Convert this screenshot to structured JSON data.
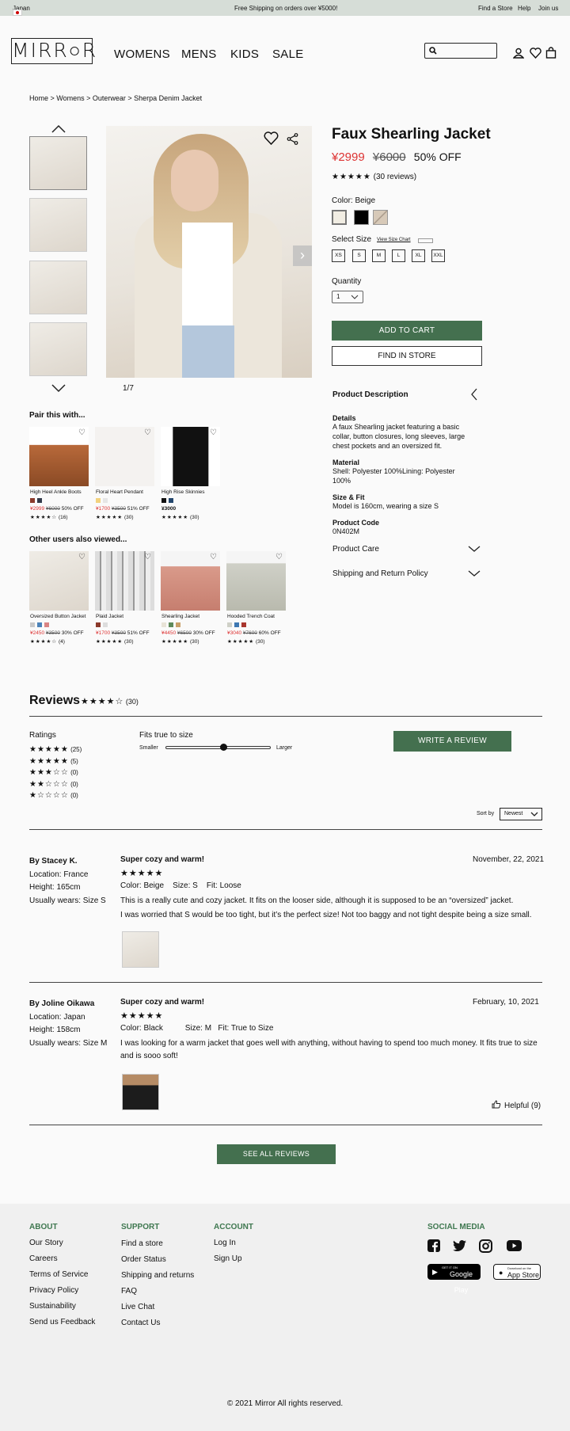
{
  "topbar": {
    "country": "Japan",
    "promo": "Free Shipping on orders over ¥5000!",
    "find_store": "Find a Store",
    "help": "Help",
    "join": "Join us"
  },
  "brand": {
    "logo": "MIRR○R"
  },
  "nav": {
    "womens": "WOMENS",
    "mens": "MENS",
    "kids": "KIDS",
    "sale": "SALE"
  },
  "breadcrumb": "Home > Womens > Outerwear > Sherpa Denim Jacket",
  "gallery": {
    "counter": "1/7"
  },
  "product": {
    "title": "Faux Shearling Jacket",
    "price": "¥2999",
    "old_price": "¥6000",
    "discount": "50% OFF",
    "stars": "★★★★★",
    "reviews": "(30 reviews)",
    "color_label": "Color: Beige",
    "colors": [
      "#f1ede3",
      "#000000",
      "#cbb9a7"
    ],
    "size_label": "Select Size",
    "size_chart": "View Size Chart",
    "sizes": [
      "XS",
      "S",
      "M",
      "L",
      "XL",
      "XXL"
    ],
    "quantity_label": "Quantity",
    "quantity": "1",
    "add_to_cart": "ADD TO CART",
    "find_in_store": "FIND IN STORE",
    "desc_title": "Product Description",
    "details_title": "Details",
    "details": "A faux Shearling jacket featuring a basic collar, button closures, long sleeves, large chest pockets and an oversized fit.",
    "material_title": "Material",
    "material": "Shell: Polyester 100%Lining: Polyester 100%",
    "fit_title": "Size & Fit",
    "fit": "Model is 160cm, wearing a size S",
    "code_title": "Product Code",
    "code": "0N402M",
    "care": "Product Care",
    "shipping": "Shipping and Return Policy"
  },
  "pair": {
    "title": "Pair this with...",
    "items": [
      {
        "name": "High Heel Ankle Boots",
        "price": "¥2999",
        "old": "¥6000",
        "off": "50% OFF",
        "stars": "★★★★☆",
        "count": "(16)",
        "colors": [
          "#8b3b2b",
          "#333a4a"
        ]
      },
      {
        "name": "Floral Heart Pendant",
        "price": "¥1700",
        "old": "¥3500",
        "off": "51% OFF",
        "stars": "★★★★★",
        "count": "(30)",
        "colors": [
          "#f2d27e",
          "#e6e6e6"
        ]
      },
      {
        "name": "High Rise Skinnies",
        "price": "¥3000",
        "old": "",
        "off": "",
        "stars": "★★★★★",
        "count": "(30)",
        "colors": [
          "#111111",
          "#23466c"
        ]
      }
    ]
  },
  "viewed": {
    "title": "Other users also viewed...",
    "items": [
      {
        "name": "Oversized Button Jacket",
        "price": "¥2450",
        "old": "¥3500",
        "off": "30% OFF",
        "stars": "★★★★☆",
        "count": "(4)",
        "colors": [
          "#c9c9c9",
          "#4d83b9",
          "#d98484"
        ]
      },
      {
        "name": "Plaid Jacket",
        "price": "¥1700",
        "old": "¥3500",
        "off": "51% OFF",
        "stars": "★★★★★",
        "count": "(30)",
        "colors": [
          "#8b3a2b",
          "#dddddd"
        ]
      },
      {
        "name": "Shearling Jacket",
        "price": "¥4450",
        "old": "¥6500",
        "off": "30% OFF",
        "stars": "★★★★★",
        "count": "(30)",
        "colors": [
          "#e8e3d7",
          "#5e8a5b",
          "#c9a06a"
        ]
      },
      {
        "name": "Hooded Trench Coat",
        "price": "¥3040",
        "old": "¥7600",
        "off": "60% OFF",
        "stars": "★★★★★",
        "count": "(30)",
        "colors": [
          "#cfd0c7",
          "#3e78b2",
          "#a9362e"
        ]
      }
    ]
  },
  "reviews": {
    "title": "Reviews",
    "stars": "★★★★☆",
    "count": "(30)",
    "ratings_label": "Ratings",
    "rating_rows": [
      {
        "stars": "★★★★★",
        "count": "(25)"
      },
      {
        "stars": "★★★★★",
        "count": "(5)"
      },
      {
        "stars": "★★★☆☆",
        "count": "(0)"
      },
      {
        "stars": "★★☆☆☆",
        "count": "(0)"
      },
      {
        "stars": "★☆☆☆☆",
        "count": "(0)"
      }
    ],
    "fit_label": "Fits true to size",
    "smaller": "Smaller",
    "larger": "Larger",
    "fit_value": 0.55,
    "write": "WRITE A REVIEW",
    "sort_label": "Sort by",
    "sort_value": "Newest",
    "list": [
      {
        "author": "By Stacey K.",
        "location": "Location: France",
        "height": "Height: 165cm",
        "wears": "Usually wears: Size S",
        "title": "Super cozy and warm!",
        "date": "November, 22, 2021",
        "stars": "★★★★★",
        "meta": "Color: Beige    Size: S    Fit: Loose",
        "text1": "This is a really cute and cozy jacket. It fits on the looser side, although it is supposed to be an “oversized” jacket.",
        "text2": "I was worried that S would be too tight, but it’s the perfect size! Not too baggy and not tight despite being a size small."
      },
      {
        "author": "By Joline Oikawa",
        "location": "Location: Japan",
        "height": "Height: 158cm",
        "wears": "Usually wears: Size M",
        "title": "Super cozy and warm!",
        "date": "February, 10, 2021",
        "stars": "★★★★★",
        "meta": "Color: Black          Size: M   Fit: True to Size",
        "text1": "I was looking for a warm jacket that goes well with anything, without having to spend too much money. It fits true to size",
        "text2": "and is sooo soft!",
        "helpful": "Helpful (9)"
      }
    ],
    "see_all": "SEE ALL REVIEWS"
  },
  "footer": {
    "about": "ABOUT",
    "about_items": [
      "Our Story",
      "Careers",
      "Terms of Service",
      "Privacy Policy",
      "Sustainability",
      "Send us Feedback"
    ],
    "support": "SUPPORT",
    "support_items": [
      "Find a store",
      "Order Status",
      "Shipping and returns",
      "FAQ",
      "Live Chat",
      "Contact Us"
    ],
    "account": "ACCOUNT",
    "account_items": [
      "Log In",
      "Sign Up"
    ],
    "social": "SOCIAL MEDIA",
    "google_play": "Google Play",
    "google_small": "GET IT ON",
    "app_store": "App Store",
    "app_small": "Download on the",
    "copyright": "© 2021 Mirror All rights reserved."
  }
}
